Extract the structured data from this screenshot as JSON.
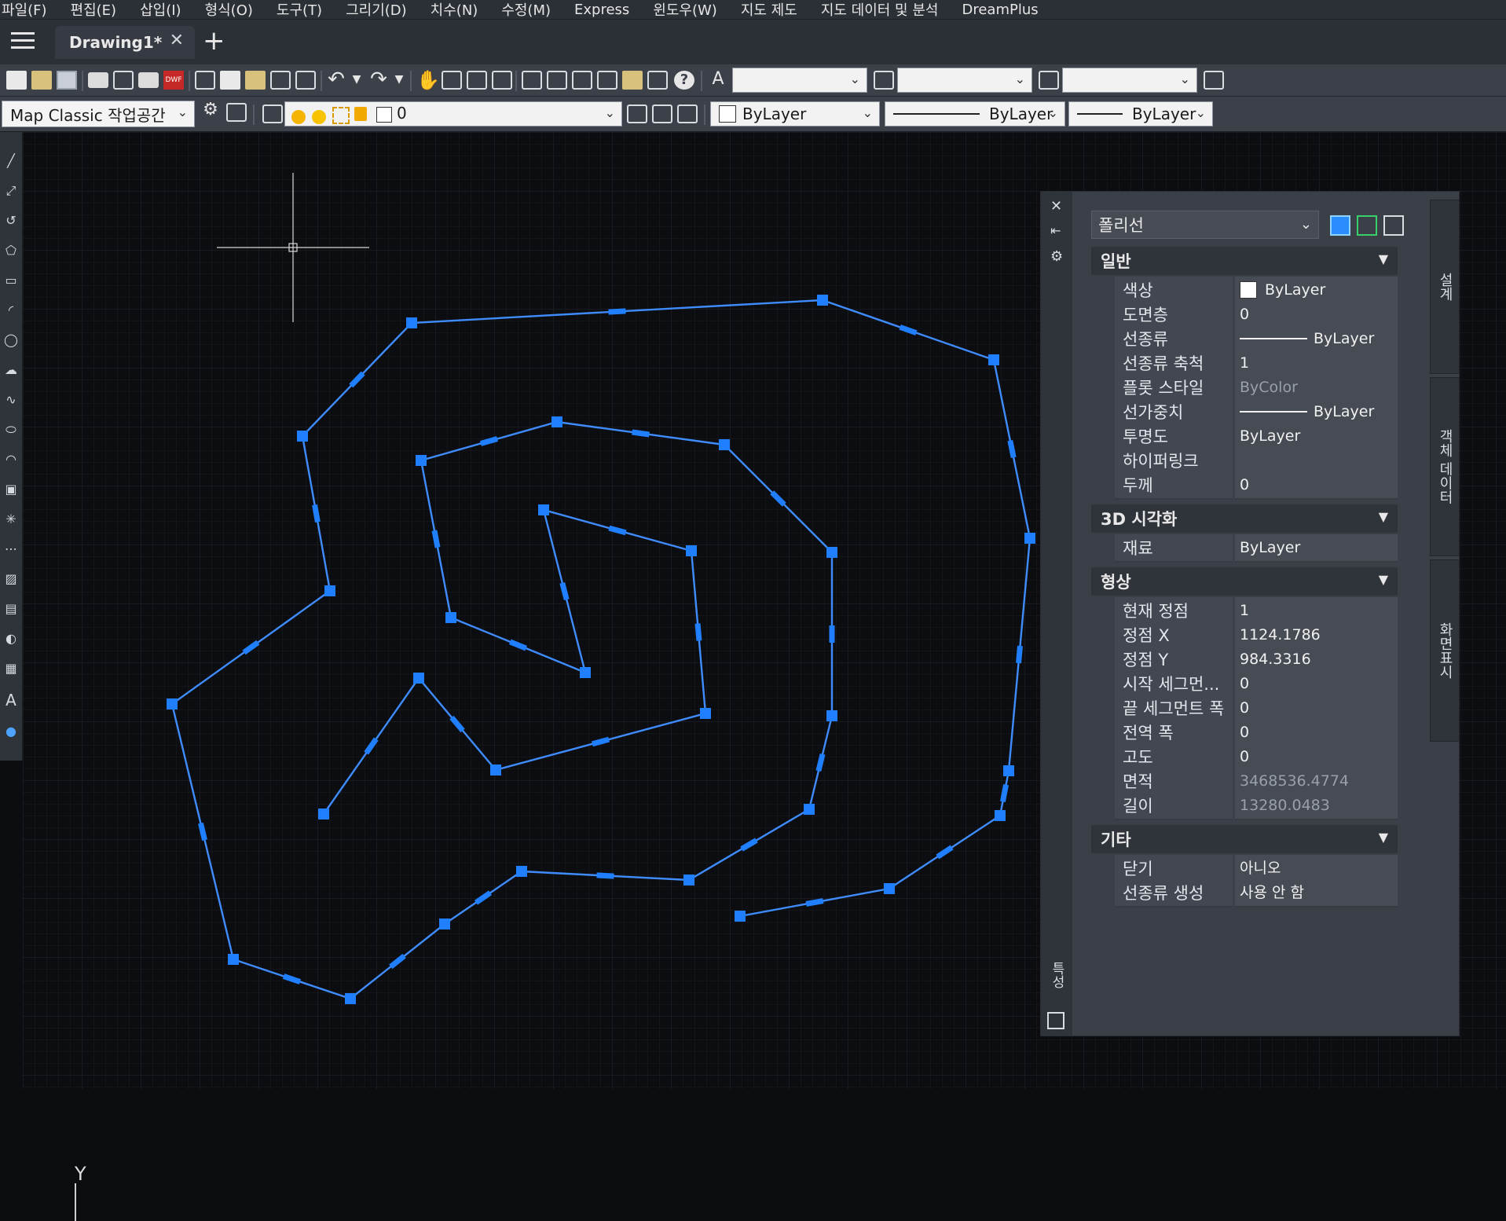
{
  "menu": [
    "파일(F)",
    "편집(E)",
    "삽입(I)",
    "형식(O)",
    "도구(T)",
    "그리기(D)",
    "치수(N)",
    "수정(M)",
    "Express",
    "윈도우(W)",
    "지도 제도",
    "지도 데이터 및 분석",
    "DreamPlus"
  ],
  "tabs": {
    "active": "Drawing1*",
    "close": "✕",
    "new": "+"
  },
  "toolbar2": {
    "workspace": "Map Classic 작업공간",
    "layer": "0",
    "color": "ByLayer",
    "linetype": "ByLayer",
    "lineweight": "ByLayer"
  },
  "canvas": {
    "ucs_label": "Y",
    "polyline_color": "#3f8cff",
    "grip_color": "#1f7fff"
  },
  "properties": {
    "object_type": "폴리선",
    "sections": {
      "general": {
        "title": "일반",
        "rows": [
          {
            "label": "색상",
            "value": "ByLayer"
          },
          {
            "label": "도면층",
            "value": "0"
          },
          {
            "label": "선종류",
            "value": "ByLayer"
          },
          {
            "label": "선종류 축척",
            "value": "1"
          },
          {
            "label": "플롯 스타일",
            "value": "ByColor"
          },
          {
            "label": "선가중치",
            "value": "ByLayer"
          },
          {
            "label": "투명도",
            "value": "ByLayer"
          },
          {
            "label": "하이퍼링크",
            "value": ""
          },
          {
            "label": "두께",
            "value": "0"
          }
        ]
      },
      "viz3d": {
        "title": "3D 시각화",
        "rows": [
          {
            "label": "재료",
            "value": "ByLayer"
          }
        ]
      },
      "geometry": {
        "title": "형상",
        "rows": [
          {
            "label": "현재 정점",
            "value": "1"
          },
          {
            "label": "정점 X",
            "value": "1124.1786"
          },
          {
            "label": "정점 Y",
            "value": "984.3316"
          },
          {
            "label": "시작 세그먼...",
            "value": "0"
          },
          {
            "label": "끝 세그먼트 폭",
            "value": "0"
          },
          {
            "label": "전역 폭",
            "value": "0"
          },
          {
            "label": "고도",
            "value": "0"
          },
          {
            "label": "면적",
            "value": "3468536.4774"
          },
          {
            "label": "길이",
            "value": "13280.0483"
          }
        ]
      },
      "misc": {
        "title": "기타",
        "rows": [
          {
            "label": "닫기",
            "value": "아니오"
          },
          {
            "label": "선종류 생성",
            "value": "사용 안 함"
          }
        ]
      }
    },
    "side_tabs": [
      "설계",
      "객체 데이터",
      "화면표시"
    ],
    "panel_title": "특성"
  }
}
